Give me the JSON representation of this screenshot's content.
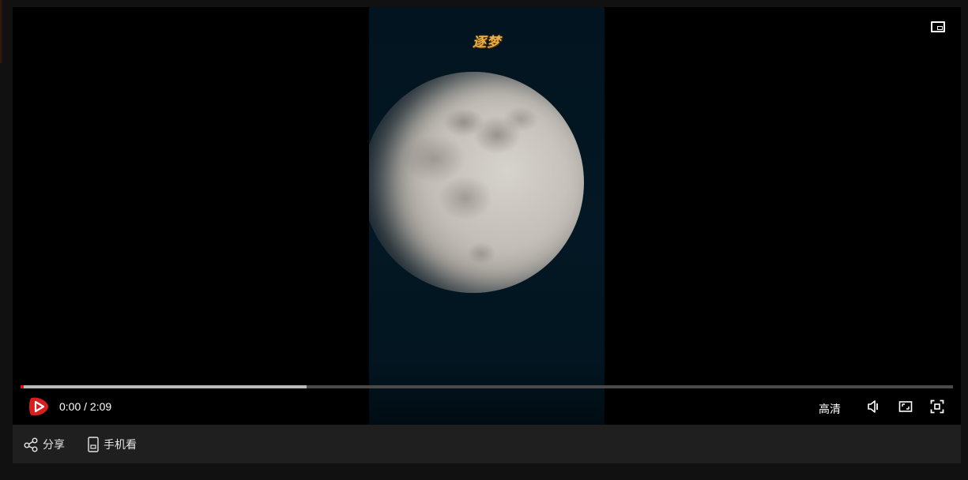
{
  "video": {
    "watermark": "逐梦",
    "progress_played_fraction": 0.003,
    "progress_buffered_fraction": 0.307
  },
  "controls": {
    "time": "0:00 / 2:09",
    "quality": "高清"
  },
  "actions": {
    "share": "分享",
    "mobile": "手机看"
  },
  "colors": {
    "progress_played": "#e31414",
    "progress_buffer": "#b9b9b9",
    "logo_red": "#d81e1e",
    "watermark_gold": "#e9b04a"
  },
  "icons": {
    "pip": "picture-in-picture-icon",
    "logo": "play-logo-icon",
    "volume": "volume-icon",
    "theater": "theater-mode-icon",
    "fullscreen": "fullscreen-icon",
    "share": "share-icon",
    "mobile": "mobile-phone-icon"
  }
}
